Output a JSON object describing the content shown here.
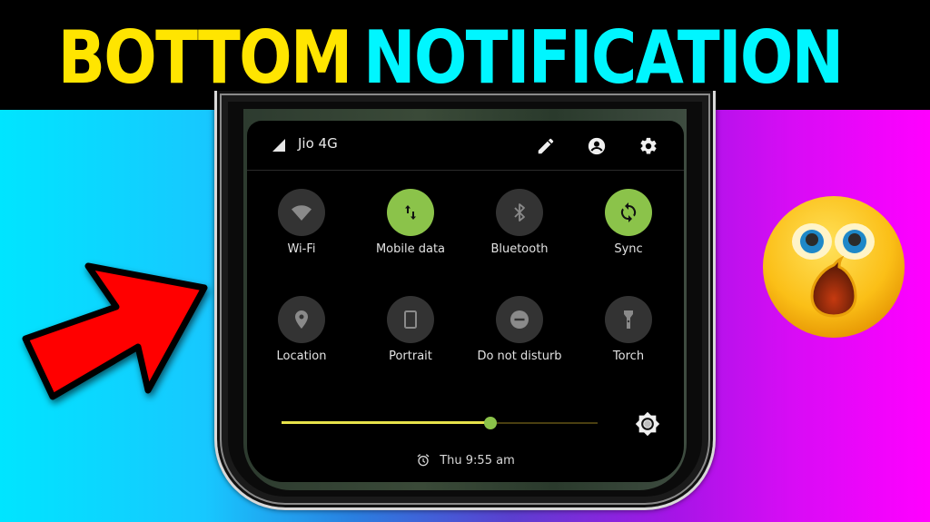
{
  "banner": {
    "word1": "BOTTOM",
    "word2": "NOTIFICATION",
    "word1_color": "#ffe500",
    "word2_color": "#00f6ff"
  },
  "background": {
    "left_color": "#00e5ff",
    "right_color": "#ff00ff"
  },
  "decorations": {
    "arrow": {
      "icon": "red-arrow-icon",
      "color": "#ff0000"
    },
    "emoji": {
      "icon": "shocked-face-emoji"
    }
  },
  "quick_settings": {
    "status": {
      "signal_icon": "signal-icon",
      "carrier": "Jio 4G",
      "actions": [
        {
          "name": "edit",
          "icon": "pencil-icon"
        },
        {
          "name": "user",
          "icon": "account-icon"
        },
        {
          "name": "settings",
          "icon": "gear-icon"
        }
      ]
    },
    "tiles": [
      {
        "label": "Wi-Fi",
        "icon": "wifi-icon",
        "active": false
      },
      {
        "label": "Mobile data",
        "icon": "mobile-data-icon",
        "active": true
      },
      {
        "label": "Bluetooth",
        "icon": "bluetooth-icon",
        "active": false
      },
      {
        "label": "Sync",
        "icon": "sync-icon",
        "active": true
      },
      {
        "label": "Location",
        "icon": "location-icon",
        "active": false
      },
      {
        "label": "Portrait",
        "icon": "portrait-icon",
        "active": false
      },
      {
        "label": "Do not disturb",
        "icon": "dnd-icon",
        "active": false
      },
      {
        "label": "Torch",
        "icon": "torch-icon",
        "active": false
      }
    ],
    "brightness": {
      "value": 0.66,
      "icon": "auto-brightness-icon"
    },
    "alarm": {
      "icon": "alarm-icon",
      "text": "Thu 9:55 am"
    },
    "colors": {
      "active": "#8bc34a",
      "inactive": "#333333",
      "slider_fill": "#e6e24a"
    }
  }
}
